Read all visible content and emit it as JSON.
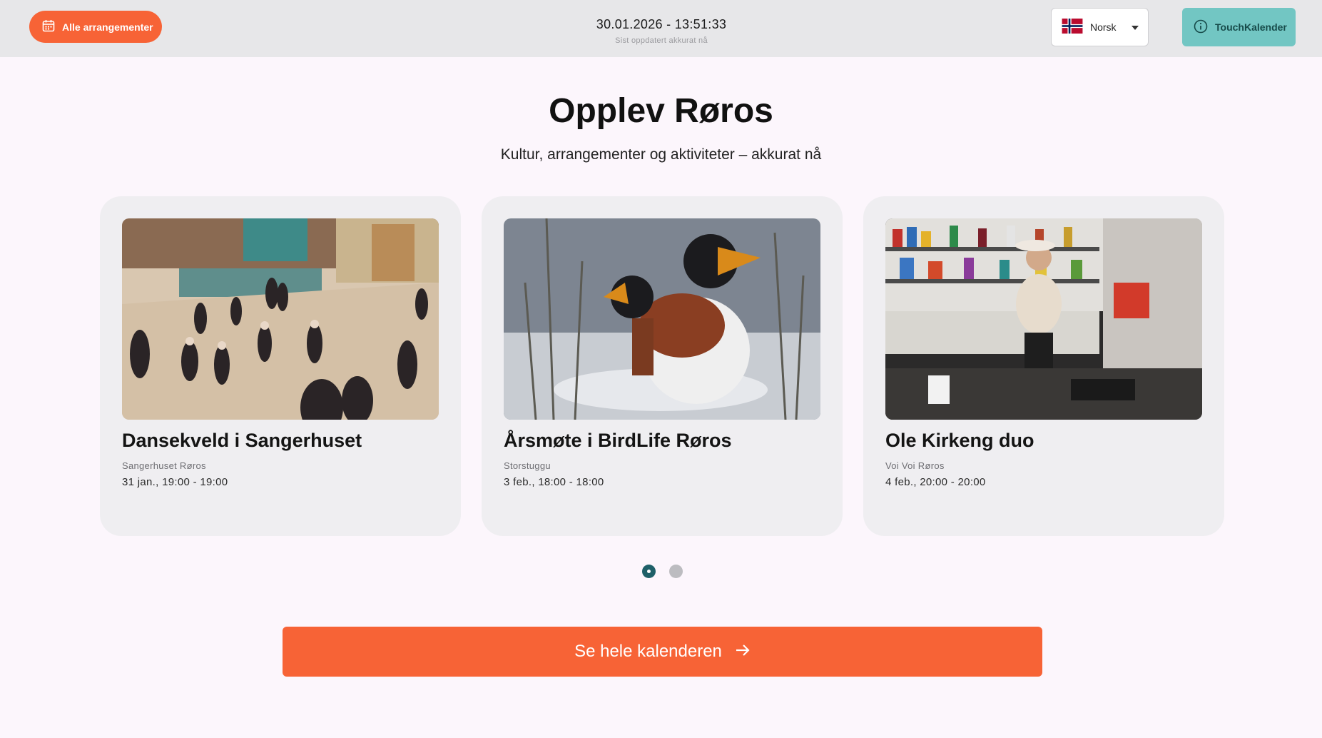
{
  "header": {
    "all_events_label": "Alle arrangementer",
    "datetime": "30.01.2026 - 13:51:33",
    "last_updated": "Sist oppdatert akkurat nå",
    "language": "Norsk",
    "touch_label": "TouchKalender"
  },
  "hero": {
    "title": "Opplev Røros",
    "subtitle": "Kultur, arrangementer og aktiviteter – akkurat nå"
  },
  "events": [
    {
      "title": "Dansekveld i Sangerhuset",
      "venue": "Sangerhuset Røros",
      "when": "31 jan., 19:00 - 19:00"
    },
    {
      "title": "Årsmøte i BirdLife Røros",
      "venue": "Storstuggu",
      "when": "3 feb., 18:00 - 18:00"
    },
    {
      "title": "Ole Kirkeng duo",
      "venue": "Voi Voi Røros",
      "when": "4 feb., 20:00 - 20:00"
    }
  ],
  "carousel": {
    "pages": 2,
    "current": 1
  },
  "cta": {
    "label": "Se hele kalenderen"
  },
  "colors": {
    "accent": "#f76336",
    "teal": "#72c6c3",
    "active_dot": "#1e6068"
  },
  "icons": [
    "calendar-icon",
    "norway-flag-icon",
    "caret-down-icon",
    "info-icon",
    "arrow-right-icon"
  ]
}
